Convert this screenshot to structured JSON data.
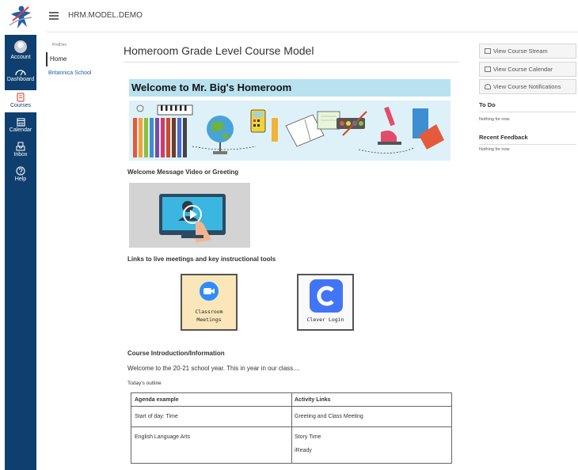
{
  "header": {
    "breadcrumb": "HRM.MODEL.DEMO"
  },
  "global_nav": [
    {
      "label": "Account",
      "icon": "avatar"
    },
    {
      "label": "Dashboard",
      "icon": "dashboard-icon"
    },
    {
      "label": "Courses",
      "icon": "courses-icon"
    },
    {
      "label": "Calendar",
      "icon": "calendar-icon"
    },
    {
      "label": "Inbox",
      "icon": "inbox-icon"
    },
    {
      "label": "Help",
      "icon": "help-icon"
    }
  ],
  "course_nav": {
    "term": "ProfDev",
    "items": [
      {
        "label": "Home"
      },
      {
        "label": "Britannica School"
      }
    ]
  },
  "main": {
    "title": "Homeroom Grade Level Course Model",
    "banner": "Welcome to Mr. Big's Homeroom",
    "video_heading": "Welcome Message Video or Greeting",
    "links_heading": "Links to live meetings and key instructional tools",
    "tile_zoom": {
      "line1": "Classroom",
      "line2": "Meetings"
    },
    "tile_clever": {
      "label": "Clever Login"
    },
    "intro_heading": "Course Introduction/Information",
    "intro_text": "Welcome to the 20-21 school year. This in year in our class....",
    "outline_label": "Today's outline",
    "agenda": {
      "headers": [
        "Agenda example",
        "Activity Links"
      ],
      "rows": [
        {
          "agenda": "Start of day: Time",
          "links": [
            "Greeting and Class Meeting"
          ]
        },
        {
          "agenda": "English Language Arts",
          "links": [
            "Story Time",
            "iReady"
          ]
        }
      ]
    }
  },
  "sidebar": {
    "buttons": [
      "View Course Stream",
      "View Course Calendar",
      "View Course Notifications"
    ],
    "todo_heading": "To Do",
    "todo_text": "Nothing for now",
    "feedback_heading": "Recent Feedback",
    "feedback_text": "Nothing for now"
  },
  "colors": {
    "nav_bg": "#0f3f6e",
    "banner_bg": "#b9e2f1",
    "zoom_blue": "#2d8cff",
    "clever_blue": "#4274f6"
  }
}
